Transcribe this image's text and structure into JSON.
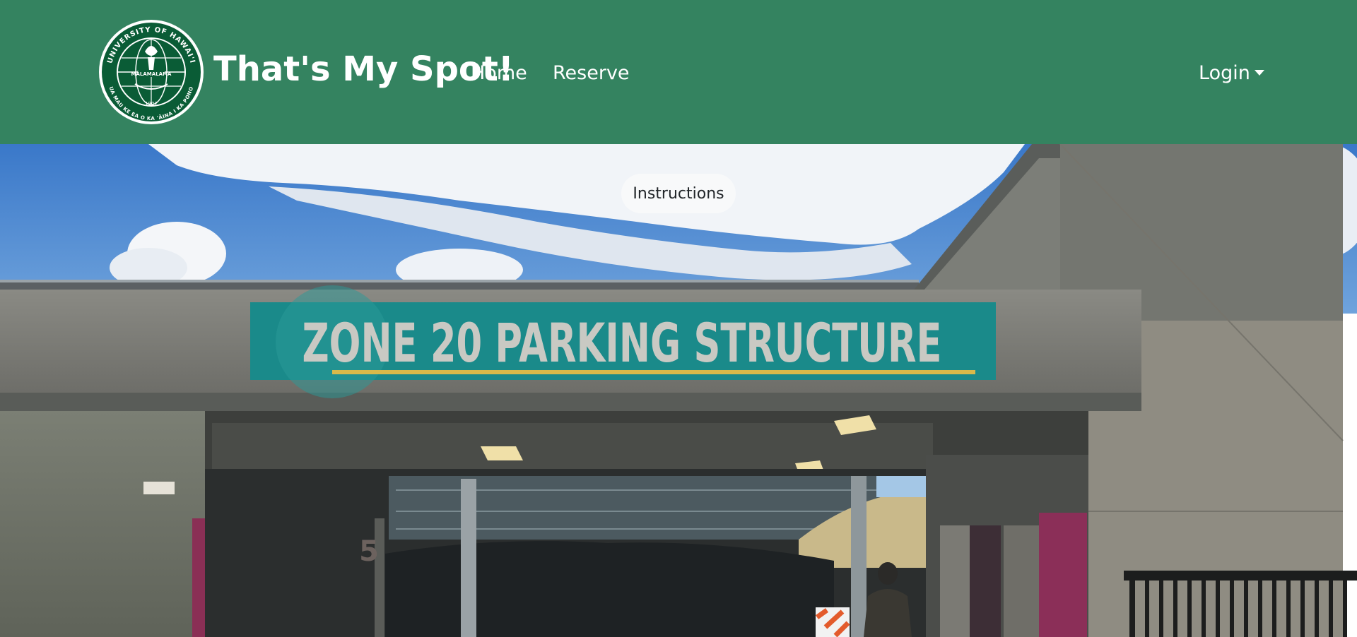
{
  "navbar": {
    "brand": "That's My Spot!",
    "links": [
      {
        "label": "Home"
      },
      {
        "label": "Reserve"
      }
    ],
    "login_label": "Login"
  },
  "logo": {
    "ring_text_top": "UNIVERSITY OF HAWAI'I",
    "ring_text_bottom": "UA MAU KE EA O KA 'ĀINA I KA PONO",
    "center_text": "MĀLAMALAMA",
    "year": "1907"
  },
  "hero": {
    "sign_text": "ZONE 20 PARKING STRUCTURE",
    "pillar_number": "5",
    "instructions_label": "Instructions"
  },
  "colors": {
    "navbar_bg": "#348360",
    "logo_green": "#0a5c36",
    "sign_teal": "#1a8a8a"
  }
}
